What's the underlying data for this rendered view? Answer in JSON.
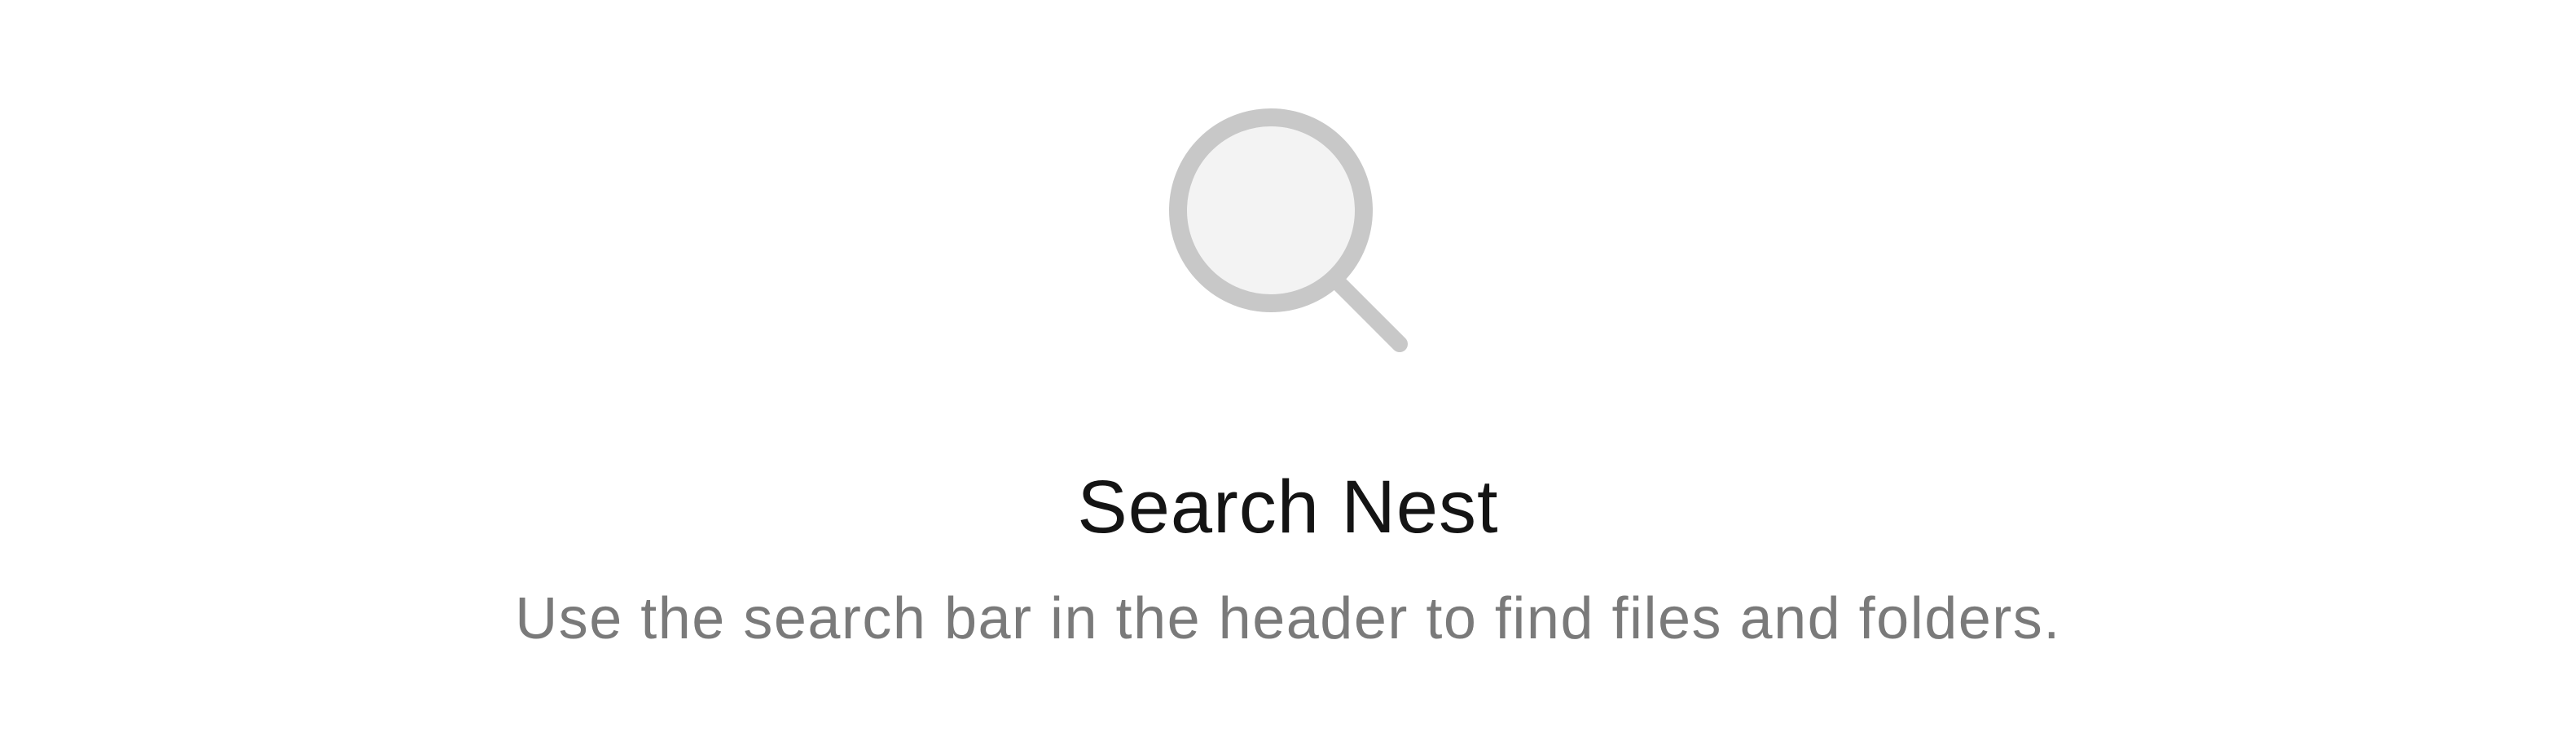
{
  "empty_state": {
    "icon": "search-icon",
    "title": "Search Nest",
    "message": "Use the search bar in the header to find files and folders."
  },
  "colors": {
    "icon_stroke": "#c8c8c8",
    "icon_fill": "#f3f3f3",
    "title": "#141414",
    "message": "#7a7a7a",
    "background": "#ffffff"
  }
}
